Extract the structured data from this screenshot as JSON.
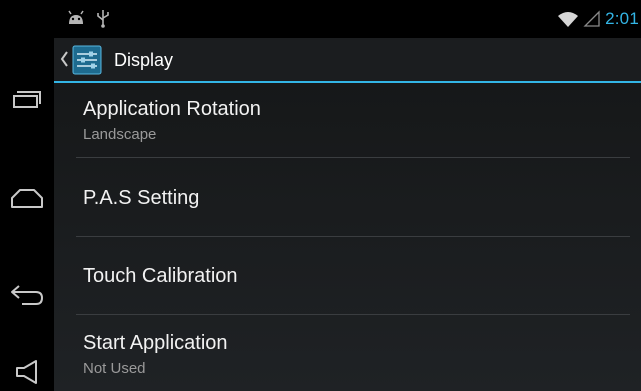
{
  "status_bar": {
    "time": "2:01",
    "icons": [
      "android-notification-icon",
      "usb-icon",
      "wifi-icon",
      "signal-icon"
    ]
  },
  "nav_bar": {
    "buttons": [
      "recent-apps-icon",
      "home-icon",
      "back-icon",
      "volume-icon"
    ]
  },
  "action_bar": {
    "title": "Display",
    "icon": "display-settings-icon",
    "accent_color": "#33b5e5"
  },
  "settings": [
    {
      "title": "Application Rotation",
      "summary": "Landscape"
    },
    {
      "title": "P.A.S Setting",
      "summary": ""
    },
    {
      "title": "Touch Calibration",
      "summary": ""
    },
    {
      "title": "Start Application",
      "summary": "Not Used"
    }
  ]
}
